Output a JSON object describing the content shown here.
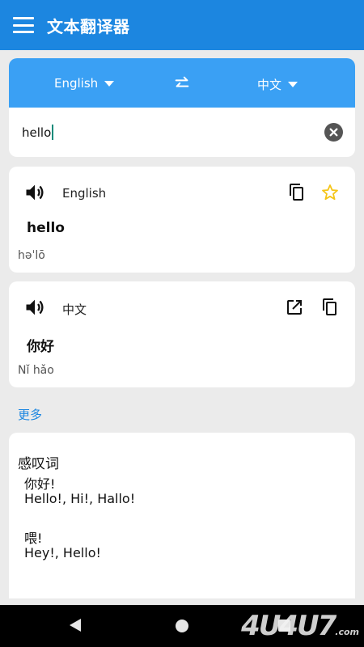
{
  "app": {
    "title": "文本翻译器"
  },
  "languages": {
    "source": "English",
    "target": "中文"
  },
  "input": {
    "value": "hello"
  },
  "source_result": {
    "language": "English",
    "text": "hello",
    "phonetic": "həˈlō"
  },
  "target_result": {
    "language": "中文",
    "text": "你好",
    "phonetic": "Nǐ hǎo"
  },
  "more": {
    "label": "更多"
  },
  "dictionary": {
    "part_of_speech": "感叹词",
    "entries": [
      {
        "word": "你好!",
        "translations": "Hello!,  Hi!,  Hallo!"
      },
      {
        "word": "喂!",
        "translations": "Hey!,  Hello!"
      }
    ]
  },
  "watermark": {
    "text": "4U4U7",
    "suffix": ".com"
  },
  "colors": {
    "primary": "#1c86e0",
    "lang_bar": "#3aa0f4",
    "star": "#f5c518"
  },
  "icons": [
    "menu-icon",
    "swap-icon",
    "clear-icon",
    "speaker-icon",
    "copy-icon",
    "star-icon",
    "open-external-icon",
    "back-icon",
    "home-icon",
    "recents-icon"
  ]
}
